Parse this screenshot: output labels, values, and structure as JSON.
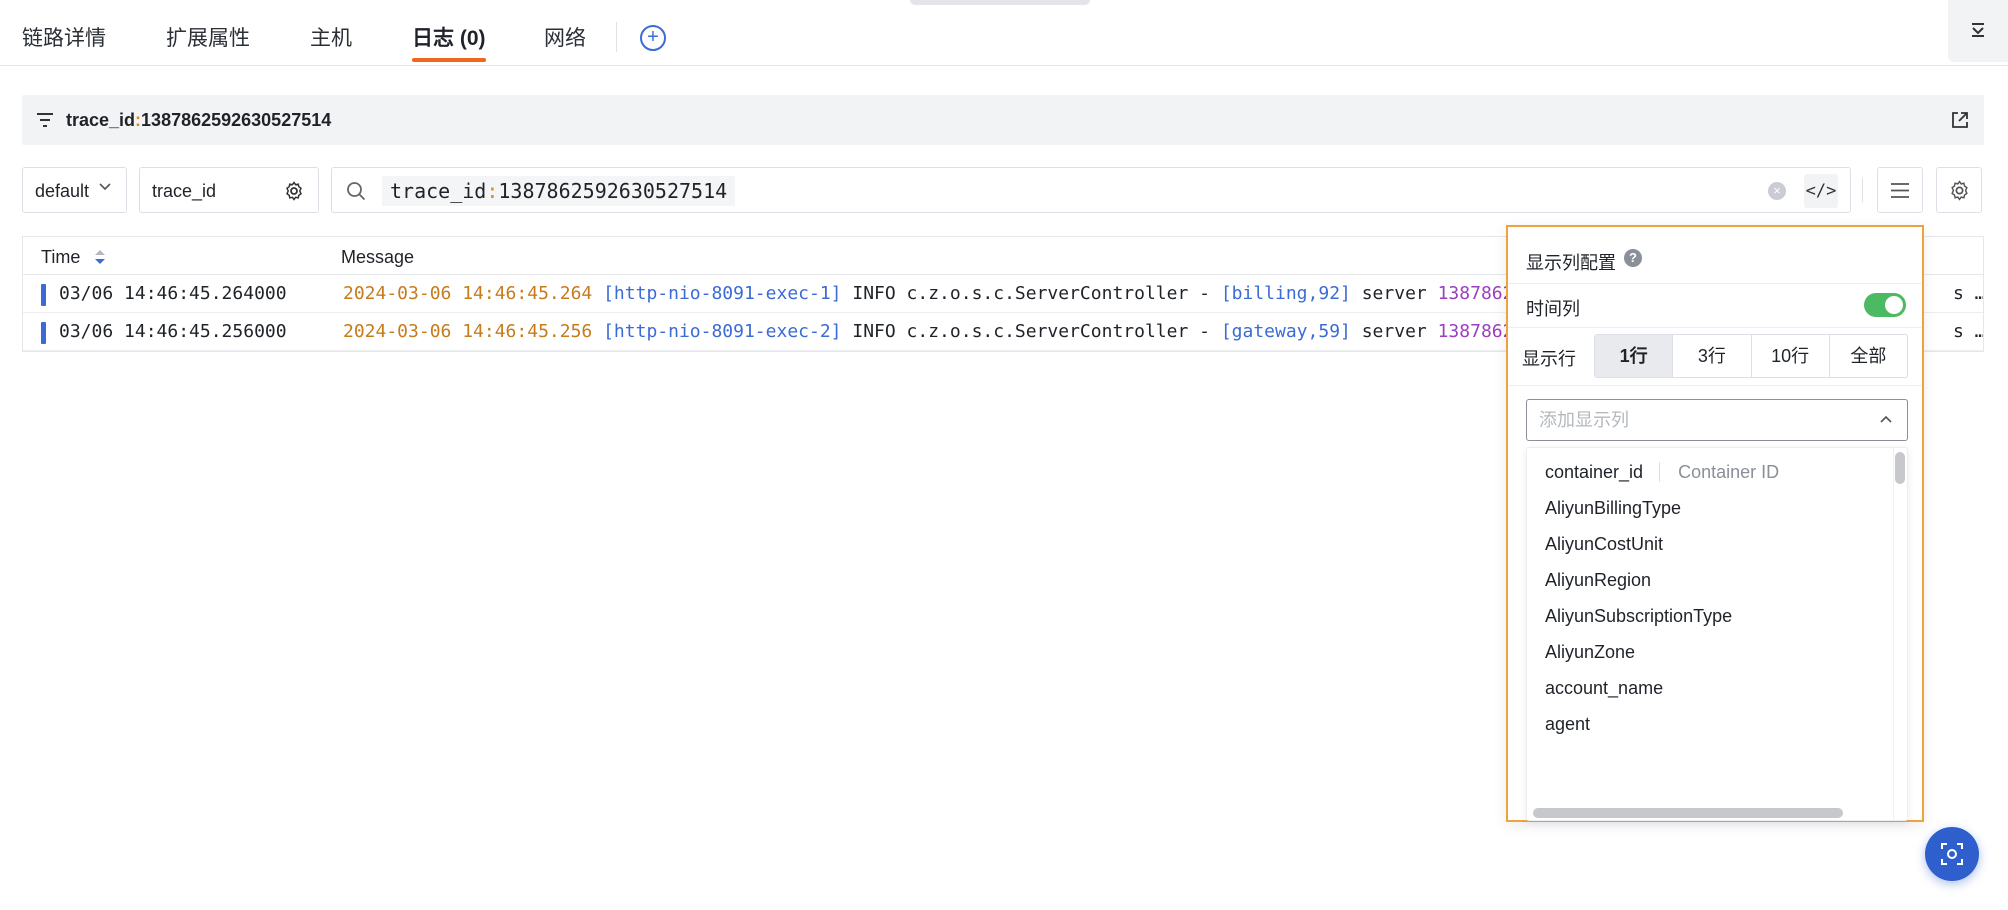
{
  "tabs": [
    {
      "label": "链路详情"
    },
    {
      "label": "扩展属性"
    },
    {
      "label": "主机"
    },
    {
      "label": "日志 (0)"
    },
    {
      "label": "网络"
    }
  ],
  "active_tab": "日志 (0)",
  "filter": {
    "key": "trace_id",
    "sep": ":",
    "value": "1387862592630527514"
  },
  "search": {
    "index_select": "default",
    "field_select": "trace_id",
    "query_key": "trace_id",
    "query_sep": ":",
    "query_value": "1387862592630527514",
    "code_toggle": "</>"
  },
  "table": {
    "headers": {
      "time": "Time",
      "message": "Message"
    },
    "rows": [
      {
        "time": "03/06 14:46:45.264000",
        "date": "2024-03-06 14:46:45.264",
        "thread": "[http-nio-8091-exec-1]",
        "level_logger": "INFO c.z.o.s.c.ServerController -",
        "ctx": "[billing,92]",
        "text": "server",
        "id": "1387862",
        "tail": "s …"
      },
      {
        "time": "03/06 14:46:45.256000",
        "date": "2024-03-06 14:46:45.256",
        "thread": "[http-nio-8091-exec-2]",
        "level_logger": "INFO c.z.o.s.c.ServerController -",
        "ctx": "[gateway,59]",
        "text": "server",
        "id": "1387862",
        "tail": "s …"
      }
    ]
  },
  "column_config": {
    "title": "显示列配置",
    "help": "?",
    "time_column_label": "时间列",
    "time_column_enabled": true,
    "rows_label": "显示行",
    "row_options": [
      "1行",
      "3行",
      "10行",
      "全部"
    ],
    "row_selected": "1行",
    "add_column_placeholder": "添加显示列",
    "options": [
      {
        "name": "container_id",
        "desc": "Container ID"
      },
      {
        "name": "AliyunBillingType"
      },
      {
        "name": "AliyunCostUnit"
      },
      {
        "name": "AliyunRegion"
      },
      {
        "name": "AliyunSubscriptionType"
      },
      {
        "name": "AliyunZone"
      },
      {
        "name": "account_name"
      },
      {
        "name": "agent"
      }
    ]
  },
  "colors": {
    "accent": "#f0661c",
    "link": "#3a6bd6",
    "toggle_on": "#4cb963",
    "popover_border": "#f0a33c"
  }
}
